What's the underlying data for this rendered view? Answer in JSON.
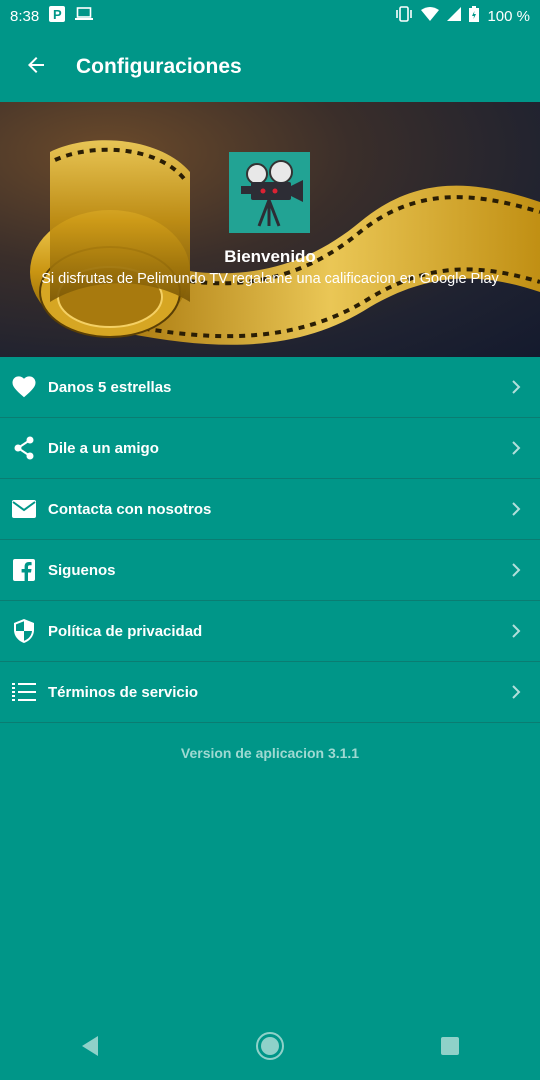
{
  "status_bar": {
    "time": "8:38",
    "battery": "100 %",
    "icons": [
      "parking-icon",
      "laptop-icon",
      "vibrate-icon",
      "wifi-icon",
      "signal-icon",
      "battery-icon"
    ]
  },
  "app_bar": {
    "title": "Configuraciones",
    "back_icon": "arrow-left-icon"
  },
  "banner": {
    "title": "Bienvenido",
    "subtitle": "Si disfrutas de Pelimundo TV regalame una calificacion en Google Play",
    "logo_icon": "movie-projector-icon"
  },
  "menu": {
    "items": [
      {
        "label": "Danos 5 estrellas",
        "icon": "heart-icon"
      },
      {
        "label": "Dile a un amigo",
        "icon": "share-icon"
      },
      {
        "label": "Contacta con nosotros",
        "icon": "mail-icon"
      },
      {
        "label": "Siguenos",
        "icon": "facebook-icon"
      },
      {
        "label": "Política de privacidad",
        "icon": "shield-icon"
      },
      {
        "label": "Términos de servicio",
        "icon": "list-icon"
      }
    ]
  },
  "version_text": "Version de aplicacion 3.1.1",
  "colors": {
    "primary": "#009688",
    "divider": "#0a7d72",
    "version_text": "#9fd9d2"
  }
}
